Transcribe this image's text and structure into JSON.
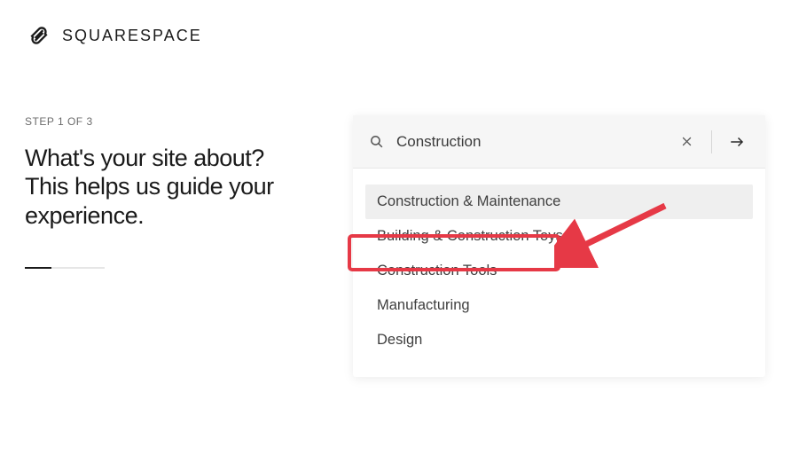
{
  "brand": {
    "name": "SQUARESPACE"
  },
  "step": {
    "label": "STEP 1 OF 3",
    "headline": "What's your site about? This helps us guide your experience."
  },
  "search": {
    "value": "Construction",
    "placeholder": ""
  },
  "suggestions": [
    {
      "label": "Construction & Maintenance",
      "highlighted": true
    },
    {
      "label": "Building & Construction Toys",
      "highlighted": false
    },
    {
      "label": "Construction Tools",
      "highlighted": false
    },
    {
      "label": "Manufacturing",
      "highlighted": false
    },
    {
      "label": "Design",
      "highlighted": false
    }
  ]
}
